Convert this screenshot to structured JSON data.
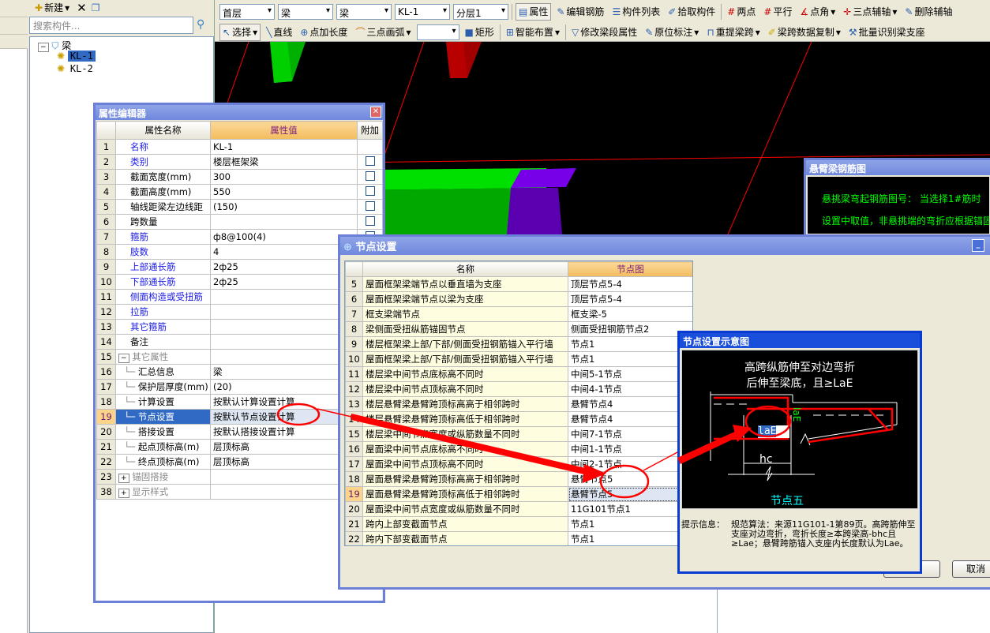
{
  "tree_panel": {
    "new_label": "新建",
    "search_placeholder": "搜索构件...",
    "root": "梁",
    "items": [
      "KL-1",
      "KL-2"
    ]
  },
  "toolbar": {
    "row1": {
      "combos": [
        "首层",
        "梁",
        "梁",
        "KL-1",
        "分层1"
      ],
      "buttons": [
        "属性",
        "编辑钢筋",
        "构件列表",
        "拾取构件",
        "两点",
        "平行",
        "点角",
        "三点辅轴",
        "删除辅轴"
      ]
    },
    "row2": {
      "buttons": [
        "选择",
        "直线",
        "点加长度",
        "三点画弧",
        "",
        "矩形",
        "智能布置",
        "修改梁段属性",
        "原位标注",
        "重提梁跨",
        "梁跨数据复制",
        "批量识别梁支座"
      ]
    }
  },
  "property_editor": {
    "title": "属性编辑器",
    "headers": [
      "属性名称",
      "属性值",
      "附加"
    ],
    "rows": [
      {
        "num": "1",
        "name": "名称",
        "value": "KL-1",
        "blue": true,
        "check": false
      },
      {
        "num": "2",
        "name": "类别",
        "value": "楼层框架梁",
        "blue": true,
        "check": true
      },
      {
        "num": "3",
        "name": "截面宽度(mm)",
        "value": "300",
        "blue": false,
        "check": true
      },
      {
        "num": "4",
        "name": "截面高度(mm)",
        "value": "550",
        "blue": false,
        "check": true
      },
      {
        "num": "5",
        "name": "轴线距梁左边线距",
        "value": "(150)",
        "blue": false,
        "check": true
      },
      {
        "num": "6",
        "name": "跨数量",
        "value": "",
        "blue": false,
        "check": true
      },
      {
        "num": "7",
        "name": "箍筋",
        "value": "ф8@100(4)",
        "blue": true,
        "check": true
      },
      {
        "num": "8",
        "name": "肢数",
        "value": "4",
        "blue": true,
        "check": true
      },
      {
        "num": "9",
        "name": "上部通长筋",
        "value": "2ф25",
        "blue": true,
        "check": true
      },
      {
        "num": "10",
        "name": "下部通长筋",
        "value": "2ф25",
        "blue": true,
        "check": true
      },
      {
        "num": "11",
        "name": "侧面构造或受扭筋",
        "value": "",
        "blue": true,
        "check": false
      },
      {
        "num": "12",
        "name": "拉筋",
        "value": "",
        "blue": true,
        "check": false
      },
      {
        "num": "13",
        "name": "其它箍筋",
        "value": "",
        "blue": true,
        "check": false
      },
      {
        "num": "14",
        "name": "备注",
        "value": "",
        "blue": false,
        "check": false
      },
      {
        "num": "15",
        "name": "其它属性",
        "value": "",
        "group": "−"
      },
      {
        "num": "16",
        "name": "汇总信息",
        "value": "梁",
        "child": true
      },
      {
        "num": "17",
        "name": "保护层厚度(mm)",
        "value": "(20)",
        "child": true
      },
      {
        "num": "18",
        "name": "计算设置",
        "value": "按默认计算设置计算",
        "child": true
      },
      {
        "num": "19",
        "name": "节点设置",
        "value": "按默认节点设置计算",
        "child": true,
        "selected": true
      },
      {
        "num": "20",
        "name": "搭接设置",
        "value": "按默认搭接设置计算",
        "child": true
      },
      {
        "num": "21",
        "name": "起点顶标高(m)",
        "value": "层顶标高",
        "child": true
      },
      {
        "num": "22",
        "name": "终点顶标高(m)",
        "value": "层顶标高",
        "child": true
      },
      {
        "num": "23",
        "name": "锚固搭接",
        "value": "",
        "group": "+"
      },
      {
        "num": "38",
        "name": "显示样式",
        "value": "",
        "group": "+"
      }
    ]
  },
  "node_settings": {
    "title": "节点设置",
    "headers": [
      "名称",
      "节点图"
    ],
    "rows": [
      {
        "num": "5",
        "name": "屋面框架梁端节点以垂直墙为支座",
        "value": "顶层节点5-4"
      },
      {
        "num": "6",
        "name": "屋面框架梁端节点以梁为支座",
        "value": "顶层节点5-4"
      },
      {
        "num": "7",
        "name": "框支梁端节点",
        "value": "框支梁-5"
      },
      {
        "num": "8",
        "name": "梁侧面受扭纵筋锚固节点",
        "value": "侧面受扭钢筋节点2"
      },
      {
        "num": "9",
        "name": "楼层框架梁上部/下部/侧面受扭钢筋锚入平行墙",
        "value": "节点1"
      },
      {
        "num": "10",
        "name": "屋面框架梁上部/下部/侧面受扭钢筋锚入平行墙",
        "value": "节点1"
      },
      {
        "num": "11",
        "name": "楼层梁中间节点底标高不同时",
        "value": "中间5-1节点"
      },
      {
        "num": "12",
        "name": "楼层梁中间节点顶标高不同时",
        "value": "中间4-1节点"
      },
      {
        "num": "13",
        "name": "楼层悬臂梁悬臂跨顶标高高于相邻跨时",
        "value": "悬臂节点4"
      },
      {
        "num": "14",
        "name": "楼层悬臂梁悬臂跨顶标高低于相邻跨时",
        "value": "悬臂节点4"
      },
      {
        "num": "15",
        "name": "楼层梁中间节点宽度或纵筋数量不同时",
        "value": "中间7-1节点"
      },
      {
        "num": "16",
        "name": "屋面梁中间节点底标高不同时",
        "value": "中间1-1节点"
      },
      {
        "num": "17",
        "name": "屋面梁中间节点顶标高不同时",
        "value": "中间2-1节点"
      },
      {
        "num": "18",
        "name": "屋面悬臂梁悬臂跨顶标高高于相邻跨时",
        "value": "悬臂节点5"
      },
      {
        "num": "19",
        "name": "屋面悬臂梁悬臂跨顶标高低于相邻跨时",
        "value": "悬臂节点5",
        "selected": true
      },
      {
        "num": "20",
        "name": "屋面梁中间节点宽度或纵筋数量不同时",
        "value": "11G101节点1"
      },
      {
        "num": "21",
        "name": "跨内上部变截面节点",
        "value": "节点1"
      },
      {
        "num": "22",
        "name": "跨内下部变截面节点",
        "value": "节点1"
      }
    ],
    "cancel_label": "取消"
  },
  "diagram": {
    "title": "节点设置示意图",
    "caption_line1": "高跨纵筋伸至对边弯折",
    "caption_line2": "后伸至梁底，且≥LaE",
    "input_value": "laE",
    "vertical_label": "laE",
    "hc_label": "hc",
    "node_name": "节点五",
    "hint_label": "提示信息：",
    "hint_text": "规范算法：来源11G101-1第89页。高跨筋伸至支座对边弯折，弯折长度≥本跨梁高-bhc且≥Lae；悬臂跨筋锚入支座内长度默认为Lae。"
  },
  "cantilever_dialog": {
    "title": "悬臂梁钢筋图",
    "line1": "悬挑梁弯起钢筋图号：  当选择1#筋时",
    "line2": "设置中取值，非悬挑端的弯折应根据锚固"
  },
  "colors": {
    "annotation": "#ff0000",
    "title_bar": "#7088dd",
    "selected_row": "#316ac5",
    "viewport_bg": "#000000",
    "beam_green": "#00e000",
    "column_purple": "#7000e0",
    "column_red": "#b00000"
  }
}
